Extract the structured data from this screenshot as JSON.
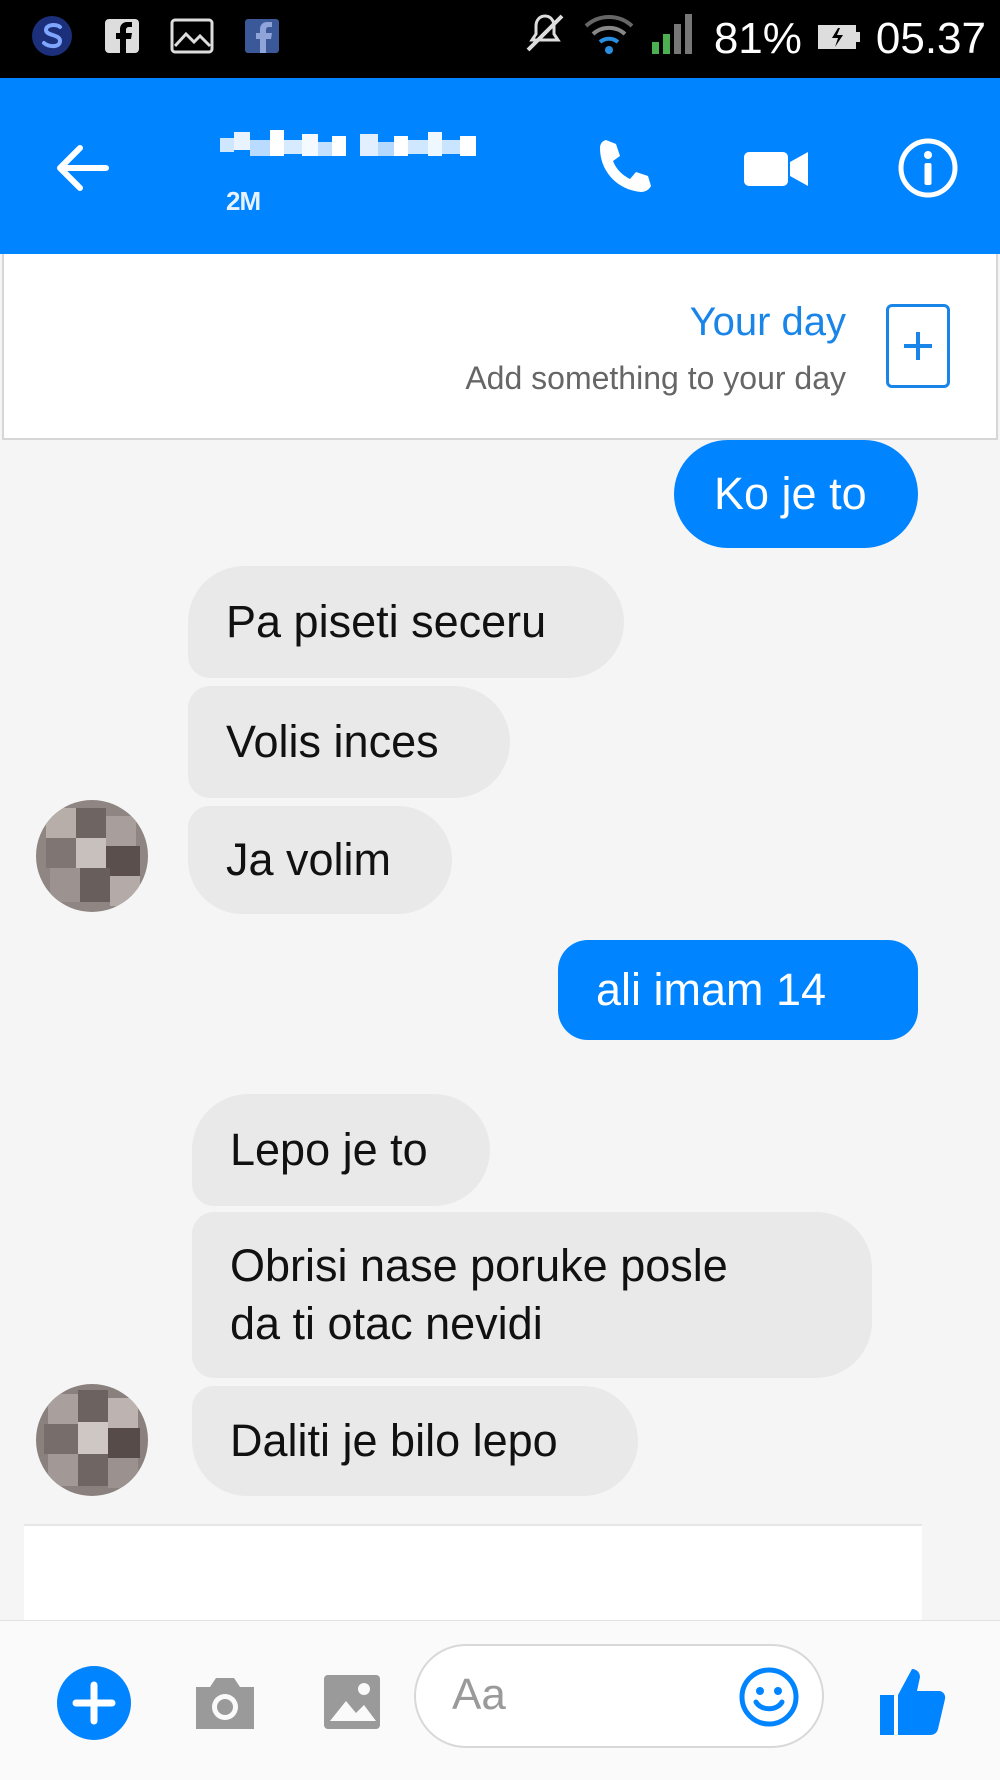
{
  "status_bar": {
    "battery": "81%",
    "time": "05.37",
    "icons": [
      "s-app-icon",
      "facebook-square-icon",
      "gallery-icon",
      "facebook-icon",
      "mute-icon",
      "wifi-icon",
      "signal-icon",
      "battery-icon"
    ]
  },
  "header": {
    "contact_name": "",
    "contact_subtitle": "2M",
    "icons": [
      "back-arrow-icon",
      "phone-icon",
      "video-camera-icon",
      "info-icon"
    ]
  },
  "your_day": {
    "title": "Your day",
    "subtitle": "Add something to your day"
  },
  "messages": [
    {
      "side": "out",
      "text": "Ko je to"
    },
    {
      "side": "in",
      "text": "Pa piseti seceru"
    },
    {
      "side": "in",
      "text": "Volis inces"
    },
    {
      "side": "in",
      "text": "Ja volim"
    },
    {
      "side": "out",
      "text": "ali imam 14"
    },
    {
      "side": "in",
      "text": "Lepo je to"
    },
    {
      "side": "in",
      "text": "Obrisi nase poruke posle da ti otac nevidi"
    },
    {
      "side": "in",
      "text": "Daliti je bilo lepo"
    }
  ],
  "composer": {
    "placeholder": "Aa",
    "icons": [
      "plus-icon",
      "camera-icon",
      "image-icon",
      "emoji-icon",
      "thumbs-up-icon"
    ]
  },
  "colors": {
    "accent": "#0084ff",
    "incoming_bubble": "#e9e9e9",
    "link_blue": "#1a85e8"
  }
}
